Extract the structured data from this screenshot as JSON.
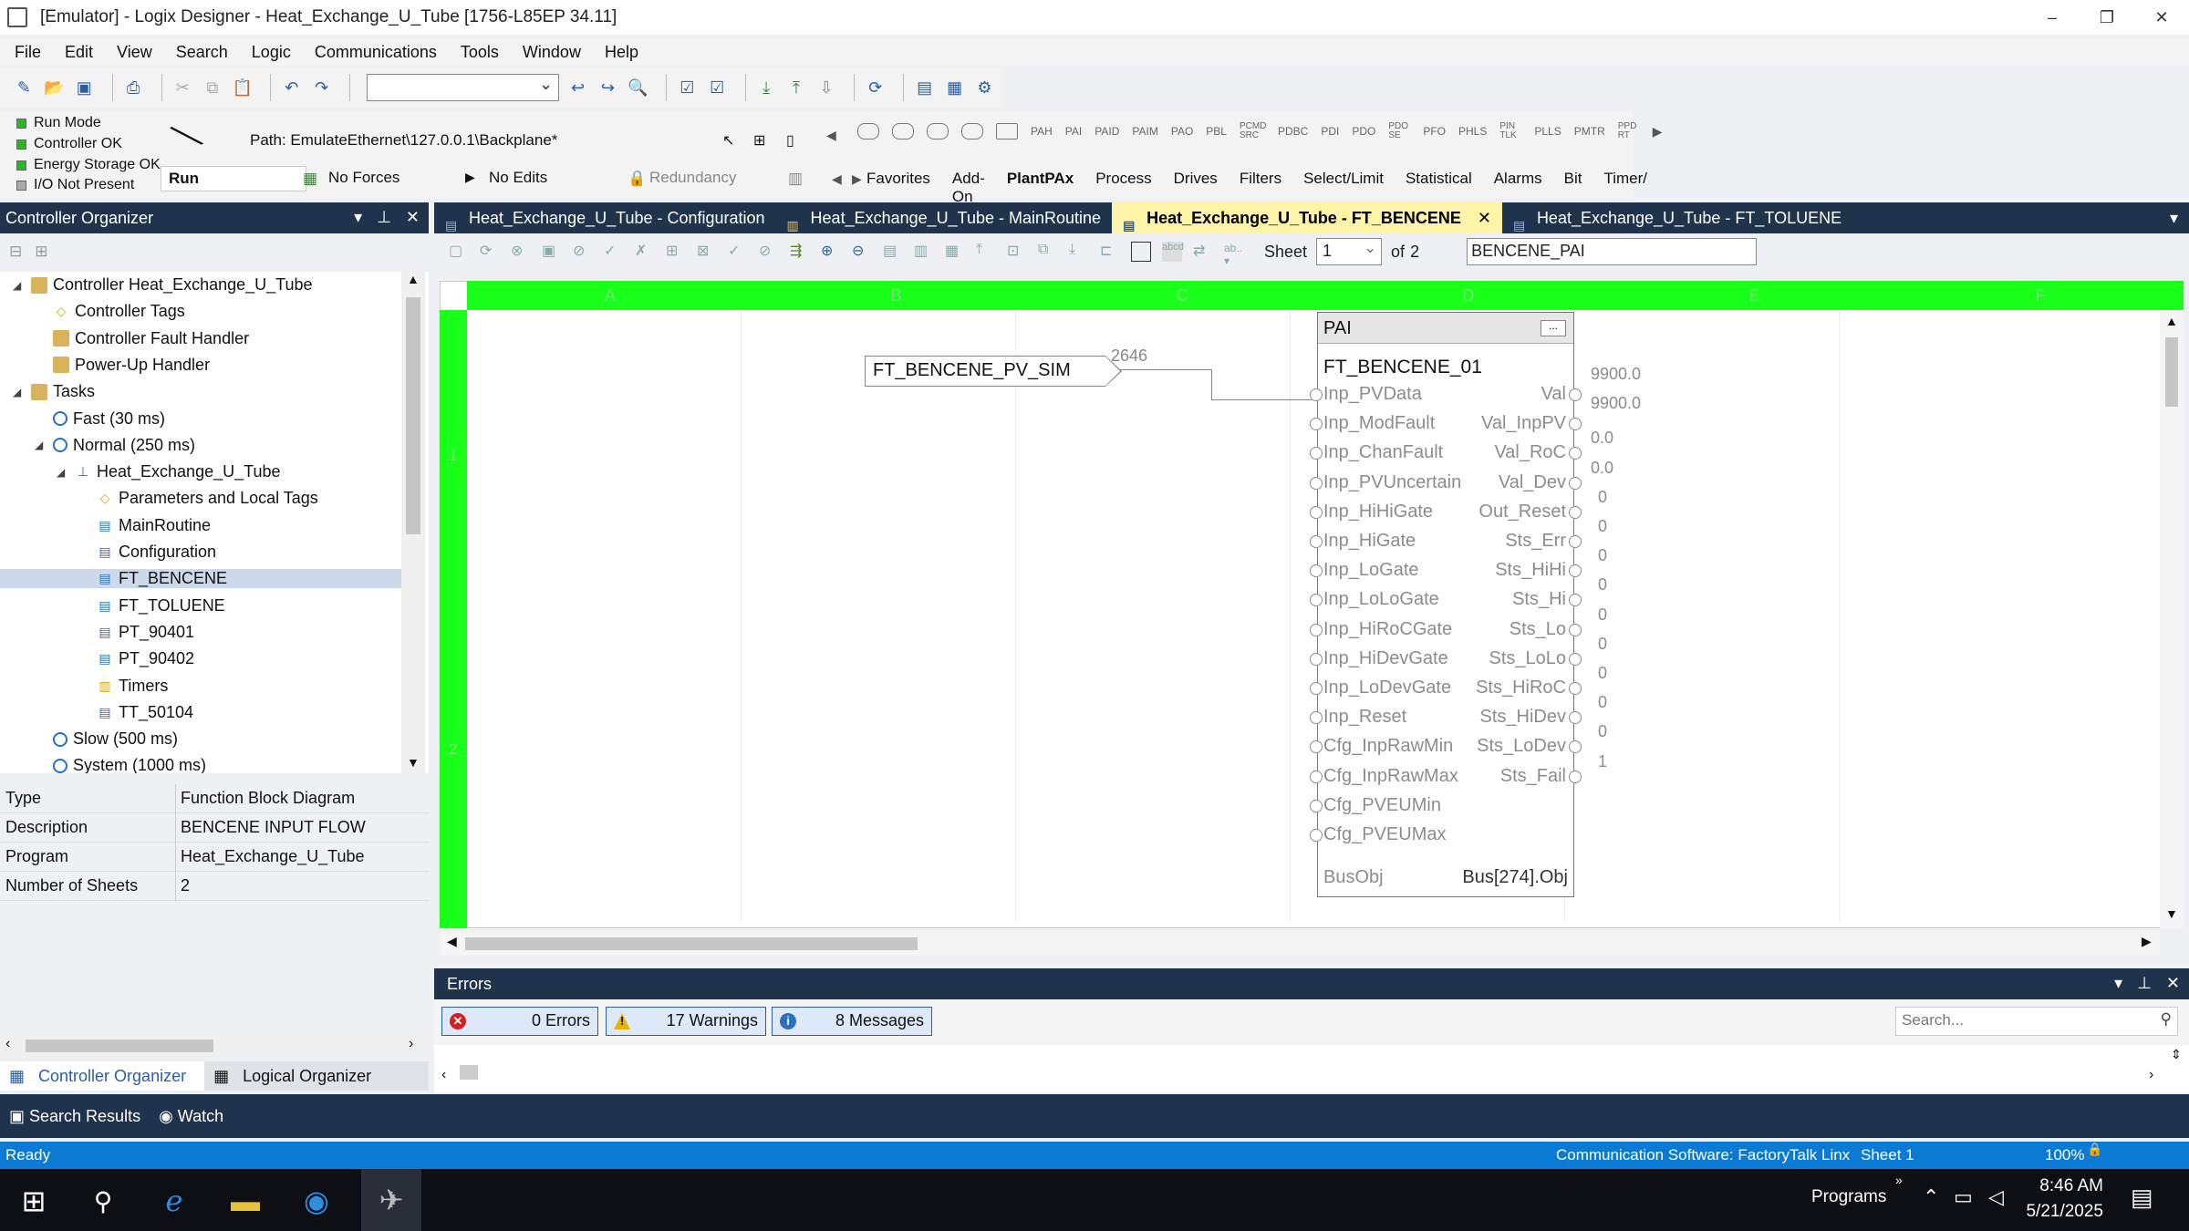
{
  "window": {
    "title": "[Emulator] - Logix Designer - Heat_Exchange_U_Tube [1756-L85EP 34.11]",
    "controls": [
      "–",
      "❐",
      "✕"
    ]
  },
  "menu": [
    "File",
    "Edit",
    "View",
    "Search",
    "Logic",
    "Communications",
    "Tools",
    "Window",
    "Help"
  ],
  "status": {
    "leds": [
      {
        "label": "Run Mode",
        "color": "#22bb22"
      },
      {
        "label": "Controller OK",
        "color": "#22bb22"
      },
      {
        "label": "Energy Storage OK",
        "color": "#22bb22"
      },
      {
        "label": "I/O Not Present",
        "color": "#aaaaaa"
      }
    ],
    "path": "Path: EmulateEthernet\\127.0.0.1\\Backplane*",
    "run_mode": "Run",
    "forces": "No Forces",
    "edits": "No Edits",
    "redundancy": "Redundancy"
  },
  "instruction_palette": [
    "PAH",
    "PAI",
    "PAID",
    "PAIM",
    "PAO",
    "PBL",
    "PCMD SRC",
    "PDBC",
    "PDI",
    "PDO",
    "PDO SE",
    "PFO",
    "PHLS",
    "PIN TLK",
    "PLLS",
    "PMTR",
    "PPD RT"
  ],
  "palette_tabs": [
    {
      "label": "Favorites",
      "active": false
    },
    {
      "label": "Add-On",
      "active": false
    },
    {
      "label": "PlantPAx",
      "active": true
    },
    {
      "label": "Process",
      "active": false
    },
    {
      "label": "Drives",
      "active": false
    },
    {
      "label": "Filters",
      "active": false
    },
    {
      "label": "Select/Limit",
      "active": false
    },
    {
      "label": "Statistical",
      "active": false
    },
    {
      "label": "Alarms",
      "active": false
    },
    {
      "label": "Bit",
      "active": false
    },
    {
      "label": "Timer/",
      "active": false
    }
  ],
  "organizer": {
    "title": "Controller Organizer",
    "tree": [
      {
        "label": "Controller Heat_Exchange_U_Tube",
        "level": 0,
        "icon": "folder",
        "exp": "◢"
      },
      {
        "label": "Controller Tags",
        "level": 1,
        "icon": "tag",
        "exp": ""
      },
      {
        "label": "Controller Fault Handler",
        "level": 1,
        "icon": "folder",
        "exp": ""
      },
      {
        "label": "Power-Up Handler",
        "level": 1,
        "icon": "folder",
        "exp": ""
      },
      {
        "label": "Tasks",
        "level": 0,
        "icon": "folder",
        "exp": "◢"
      },
      {
        "label": "Fast (30 ms)",
        "level": 1,
        "icon": "clock",
        "exp": ""
      },
      {
        "label": "Normal (250 ms)",
        "level": 1,
        "icon": "clock",
        "exp": "◢"
      },
      {
        "label": "Heat_Exchange_U_Tube",
        "level": 2,
        "icon": "program",
        "exp": "◢"
      },
      {
        "label": "Parameters and Local Tags",
        "level": 3,
        "icon": "tag",
        "exp": ""
      },
      {
        "label": "MainRoutine",
        "level": 3,
        "icon": "routine",
        "exp": ""
      },
      {
        "label": "Configuration",
        "level": 3,
        "icon": "fbd",
        "exp": ""
      },
      {
        "label": "FT_BENCENE",
        "level": 3,
        "icon": "fbd",
        "exp": "",
        "selected": true
      },
      {
        "label": "FT_TOLUENE",
        "level": 3,
        "icon": "fbd",
        "exp": ""
      },
      {
        "label": "PT_90401",
        "level": 3,
        "icon": "fbd",
        "exp": ""
      },
      {
        "label": "PT_90402",
        "level": 3,
        "icon": "fbd",
        "exp": ""
      },
      {
        "label": "Timers",
        "level": 3,
        "icon": "ladder",
        "exp": ""
      },
      {
        "label": "TT_50104",
        "level": 3,
        "icon": "fbd",
        "exp": ""
      },
      {
        "label": "Slow (500 ms)",
        "level": 1,
        "icon": "clock",
        "exp": ""
      },
      {
        "label": "System (1000 ms)",
        "level": 1,
        "icon": "clock",
        "exp": ""
      }
    ],
    "properties": [
      {
        "key": "Type",
        "value": "Function Block Diagram"
      },
      {
        "key": "Description",
        "value": "BENCENE INPUT FLOW"
      },
      {
        "key": "Program",
        "value": "Heat_Exchange_U_Tube"
      },
      {
        "key": "Number of Sheets",
        "value": "2"
      }
    ],
    "tabs": [
      {
        "label": "Controller Organizer",
        "active": true
      },
      {
        "label": "Logical Organizer",
        "active": false
      }
    ]
  },
  "bottom_panes": [
    "Search Results",
    "Watch"
  ],
  "editor_tabs": [
    {
      "label": "Heat_Exchange_U_Tube - Configuration",
      "active": false
    },
    {
      "label": "Heat_Exchange_U_Tube - MainRoutine",
      "active": false
    },
    {
      "label": "Heat_Exchange_U_Tube - FT_BENCENE",
      "active": true
    },
    {
      "label": "Heat_Exchange_U_Tube - FT_TOLUENE",
      "active": false
    }
  ],
  "sheet": {
    "label": "Sheet",
    "value": "1",
    "of": "of",
    "total": "2",
    "name": "BENCENE_PAI"
  },
  "diagram": {
    "columns": [
      "A",
      "B",
      "C",
      "D",
      "E",
      "F"
    ],
    "rows": [
      "1",
      "2"
    ],
    "input_tag": "FT_BENCENE_PV_SIM",
    "input_value": "2646",
    "block_type": "PAI",
    "block_name": "FT_BENCENE_01",
    "inputs": [
      "Inp_PVData",
      "Inp_ModFault",
      "Inp_ChanFault",
      "Inp_PVUncertain",
      "Inp_HiHiGate",
      "Inp_HiGate",
      "Inp_LoGate",
      "Inp_LoLoGate",
      "Inp_HiRoCGate",
      "Inp_HiDevGate",
      "Inp_LoDevGate",
      "Inp_Reset",
      "Cfg_InpRawMin",
      "Cfg_InpRawMax",
      "Cfg_PVEUMin",
      "Cfg_PVEUMax"
    ],
    "outputs": [
      "Val",
      "Val_InpPV",
      "Val_RoC",
      "Val_Dev",
      "Out_Reset",
      "Sts_Err",
      "Sts_HiHi",
      "Sts_Hi",
      "Sts_Lo",
      "Sts_LoLo",
      "Sts_HiRoC",
      "Sts_HiDev",
      "Sts_LoDev",
      "Sts_Fail"
    ],
    "output_values": [
      "9900.0",
      "9900.0",
      "0.0",
      "0.0",
      "0",
      "0",
      "0",
      "0",
      "0",
      "0",
      "0",
      "0",
      "0",
      "1"
    ],
    "bus_label": "BusObj",
    "bus_value": "Bus[274].Obj"
  },
  "errors": {
    "title": "Errors",
    "errors": "0 Errors",
    "warnings": "17 Warnings",
    "messages": "8 Messages",
    "search_placeholder": "Search..."
  },
  "statusbar": {
    "left": "Ready",
    "comm": "Communication Software: FactoryTalk Linx",
    "sheet": "Sheet 1",
    "zoom": "100%"
  },
  "taskbar": {
    "programs": "Programs",
    "time": "8:46 AM",
    "date": "5/21/2025"
  }
}
